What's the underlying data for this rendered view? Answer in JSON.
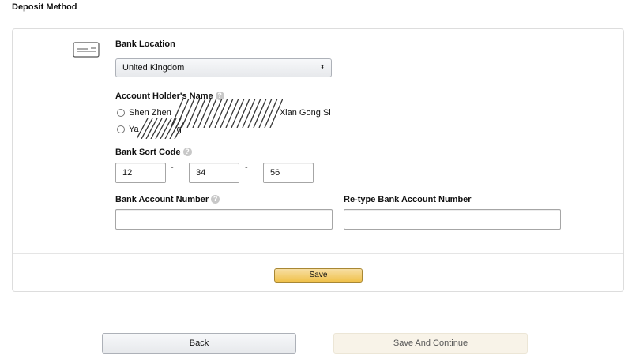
{
  "header": {
    "title": "Deposit Method"
  },
  "form": {
    "bank_icon": "bank-card-icon",
    "bank_location": {
      "label": "Bank Location",
      "value": "United Kingdom",
      "arrow": "⬍"
    },
    "account_holder": {
      "label": "Account Holder's Name",
      "help": "?",
      "options": [
        {
          "text_start": "Shen Zhen",
          "text_end": "Xian Gong Si",
          "redacted": true
        },
        {
          "text_start": "Ya",
          "text_end": "g",
          "redacted": true
        }
      ]
    },
    "sort_code": {
      "label": "Bank Sort Code",
      "help": "?",
      "parts": [
        "12",
        "34",
        "56"
      ],
      "separator": "-"
    },
    "account_number": {
      "label": "Bank Account Number",
      "help": "?",
      "value": ""
    },
    "retype_account_number": {
      "label": "Re-type Bank Account Number",
      "value": ""
    },
    "save_label": "Save"
  },
  "footer": {
    "back_label": "Back",
    "continue_label": "Save And Continue"
  },
  "colors": {
    "save_button": "#f0c14b",
    "continue_button": "#f8f3e8",
    "border": "#dddddd"
  }
}
